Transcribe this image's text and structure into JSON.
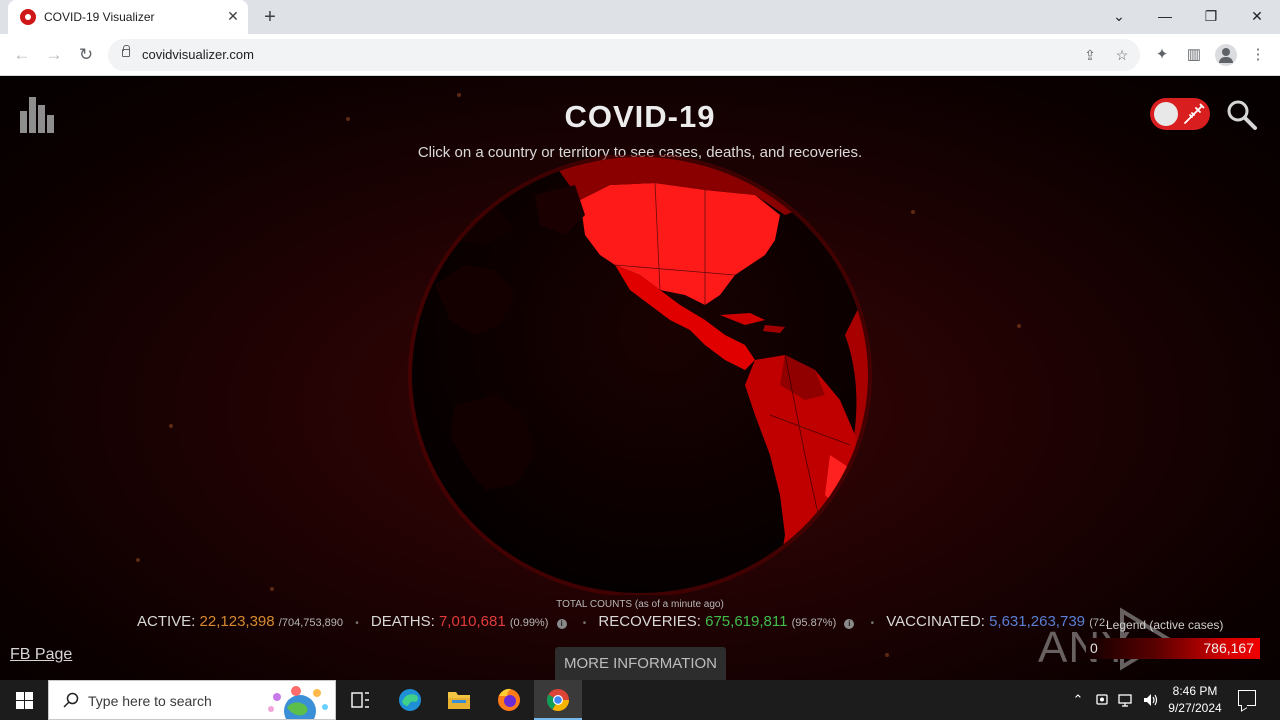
{
  "browser": {
    "tab_title": "COVID-19 Visualizer",
    "tab_close": "✕",
    "new_tab": "+",
    "url": "covidvisualizer.com",
    "window_controls": {
      "dropdown": "⌄",
      "minimize": "—",
      "restore": "❐",
      "close": "✕"
    },
    "nav": {
      "back": "←",
      "forward": "→",
      "reload": "↻"
    },
    "toolbar_icons": {
      "share": "⇪",
      "bookmark": "☆",
      "extensions": "✦",
      "side_panel": "▥",
      "menu": "⋮"
    }
  },
  "page": {
    "title": "COVID-19",
    "subtitle": "Click on a country or territory to see cases, deaths, and recoveries.",
    "total_counts_label": "TOTAL COUNTS (as of a minute ago)",
    "stats": {
      "active_label": "ACTIVE:",
      "active_value": "22,123,398",
      "active_total": "/704,753,890",
      "deaths_label": "DEATHS:",
      "deaths_value": "7,010,681",
      "deaths_pct": "(0.99%)",
      "recoveries_label": "RECOVERIES:",
      "recoveries_value": "675,619,811",
      "recoveries_pct": "(95.87%)",
      "vaccinated_label": "VACCINATED:",
      "vaccinated_value": "5,631,263,739",
      "vaccinated_pct": "(72.",
      "separator": "•",
      "info_glyph": "i"
    },
    "fb_link": "FB Page",
    "more_info_button": "MORE INFORMATION",
    "legend": {
      "label": "Legend (active cases)",
      "min": "0",
      "max": "786,167"
    },
    "watermark": "ANY RUN",
    "colors": {
      "active": "#d68a2e",
      "deaths": "#e23b3b",
      "recoveries": "#3fbf4a",
      "vaccinated": "#5a7fd6",
      "toggle": "#d81e1e"
    }
  },
  "taskbar": {
    "search_placeholder": "Type here to search",
    "time": "8:46 PM",
    "date": "9/27/2024",
    "tray_icons": {
      "chevron": "⌃",
      "volume": "🔊"
    }
  }
}
